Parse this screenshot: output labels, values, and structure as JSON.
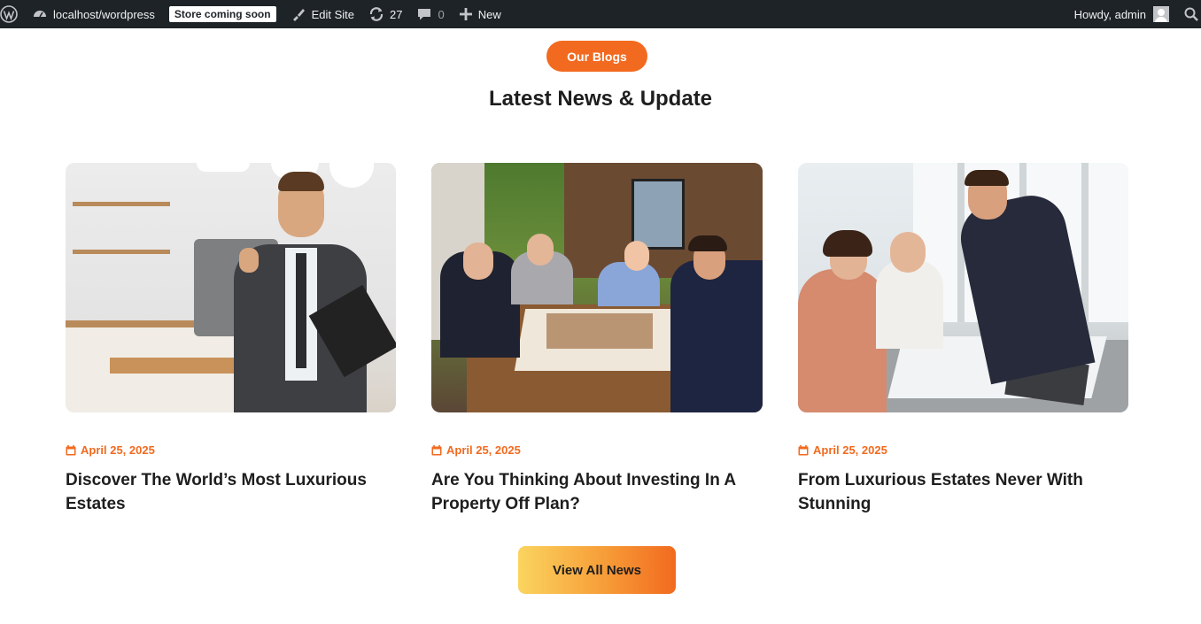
{
  "adminbar": {
    "site_url": "localhost/wordpress",
    "store_badge": "Store coming soon",
    "edit_site": "Edit Site",
    "updates_count": "27",
    "comments_count": "0",
    "new_label": "New",
    "howdy": "Howdy, admin",
    "bg_color": "#1d2327"
  },
  "section": {
    "pill_label": "Our Blogs",
    "heading": "Latest News & Update",
    "accent_color": "#f26a1f"
  },
  "posts": [
    {
      "date": "April 25, 2025",
      "title": "Discover The World’s Most Luxurious Estates",
      "icon": "calendar-icon"
    },
    {
      "date": "April 25, 2025",
      "title": "Are You Thinking About Investing In A Property Off Plan?",
      "icon": "calendar-icon"
    },
    {
      "date": "April 25, 2025",
      "title": "From Luxurious Estates Never With Stunning",
      "icon": "calendar-icon"
    }
  ],
  "cta": {
    "label": "View All News"
  }
}
